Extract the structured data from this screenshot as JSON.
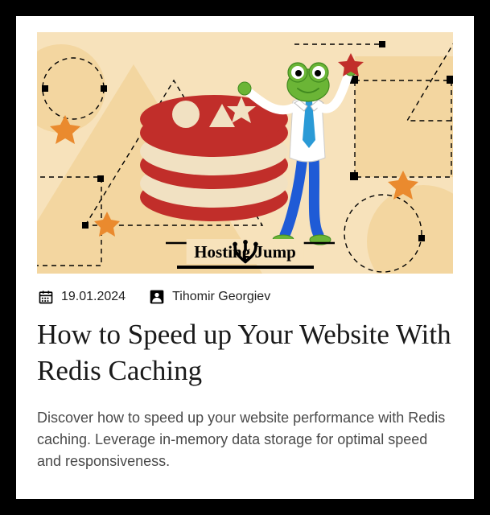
{
  "brand": "Hosting Jump",
  "post": {
    "date": "19.01.2024",
    "author": "Tihomir Georgiev",
    "title": "How to Speed up Your Website With Redis Caching",
    "excerpt": "Discover how to speed up your website performance with Redis caching. Leverage in-memory data storage for optimal speed and responsiveness."
  },
  "colors": {
    "hero_bg": "#f7e2bb",
    "redis_red": "#c12e2a",
    "redis_cream": "#f1e1c2",
    "accent_orange": "#ea8a2e",
    "frog_green": "#6bb536",
    "frog_dark": "#418a1f",
    "tie": "#2a9ad6",
    "pants": "#1f5bd6"
  }
}
